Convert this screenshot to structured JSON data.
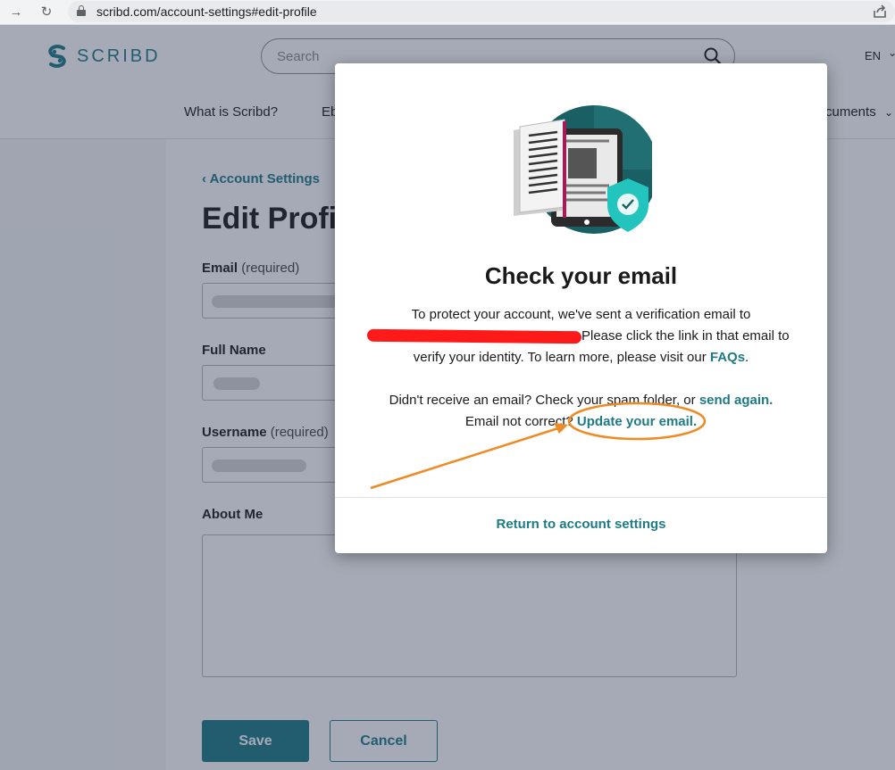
{
  "browser": {
    "back_icon": "arrow-right-icon",
    "reload_icon": "reload-icon",
    "url": "scribd.com/account-settings#edit-profile"
  },
  "header": {
    "logo_text": "SCRIBD",
    "search_placeholder": "Search",
    "language": "EN",
    "nav": [
      "What is Scribd?",
      "Eb",
      "cuments"
    ]
  },
  "profile_form": {
    "back_link": "Account Settings",
    "title": "Edit Profil",
    "email_label": "Email",
    "email_required": "(required)",
    "full_name_label": "Full Name",
    "username_label": "Username",
    "username_required": "(required)",
    "about_label": "About Me",
    "save_label": "Save",
    "cancel_label": "Cancel"
  },
  "modal": {
    "title": "Check your email",
    "line1": "To protect your account, we've sent a verification email to",
    "line2": "Please click the link in that email to",
    "line3_prefix": "verify your identity. To learn more, please visit our ",
    "faqs_link": "FAQs",
    "line3_suffix": ".",
    "line4_prefix": "Didn't receive an email? Check your spam folder, or ",
    "send_again_link": "send again.",
    "line5_prefix": "Email not correct? ",
    "update_email_link": "Update your email.",
    "return_link": "Return to account settings"
  },
  "colors": {
    "brand": "#1e7b85",
    "annotation": "#f08a24",
    "redaction": "#ff1a1a"
  }
}
